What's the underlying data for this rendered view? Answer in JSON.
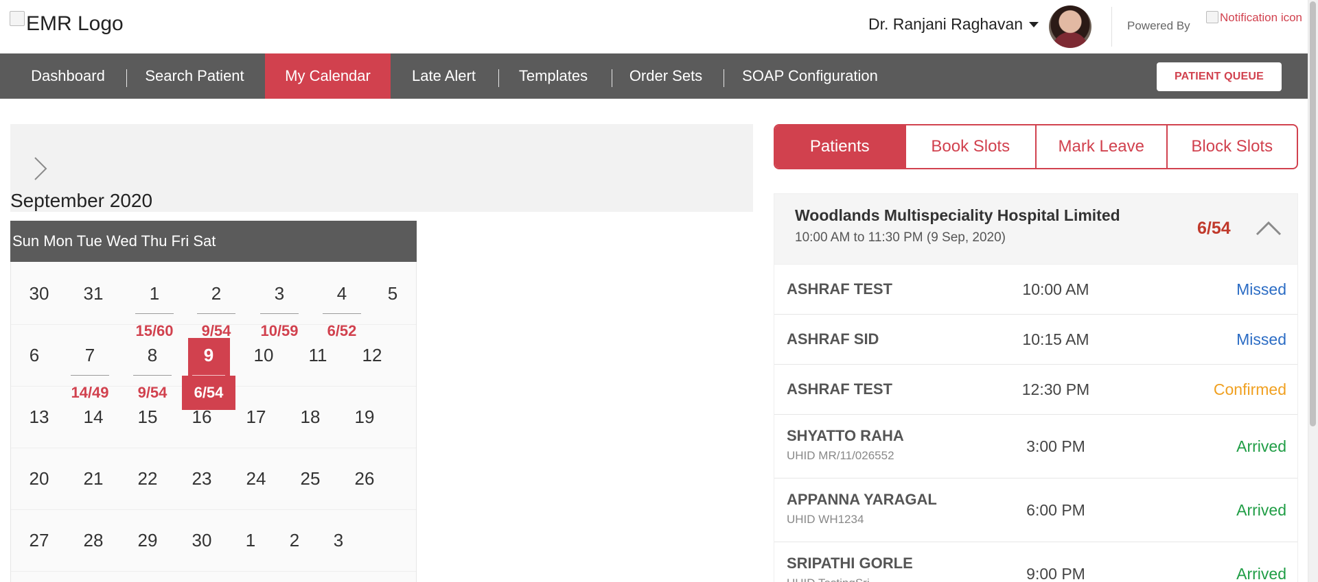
{
  "header": {
    "logo_alt": "EMR Logo",
    "user_name": "Dr. Ranjani Raghavan",
    "powered_by": "Powered By",
    "notification_alt": "Notification icon"
  },
  "nav": {
    "items": [
      "Dashboard",
      "Search Patient",
      "My Calendar",
      "Late Alert",
      "Templates",
      "Order Sets",
      "SOAP Configuration"
    ],
    "active": "My Calendar",
    "queue_button": "PATIENT QUEUE"
  },
  "calendar": {
    "month_label": "September 2020",
    "week_header": "Sun Mon Tue Wed Thu Fri Sat",
    "weeks": [
      [
        {
          "d": "30"
        },
        {
          "d": "31"
        },
        {
          "d": "1",
          "c": "15/60"
        },
        {
          "d": "2",
          "c": "9/54"
        },
        {
          "d": "3",
          "c": "10/59"
        },
        {
          "d": "4",
          "c": "6/52"
        },
        {
          "d": "5"
        }
      ],
      [
        {
          "d": "6"
        },
        {
          "d": "7",
          "c": "14/49"
        },
        {
          "d": "8",
          "c": "9/54"
        },
        {
          "d": "9",
          "c": "6/54",
          "selected": true
        },
        {
          "d": "10"
        },
        {
          "d": "11"
        },
        {
          "d": "12"
        }
      ],
      [
        {
          "d": "13"
        },
        {
          "d": "14"
        },
        {
          "d": "15"
        },
        {
          "d": "16"
        },
        {
          "d": "17"
        },
        {
          "d": "18"
        },
        {
          "d": "19"
        }
      ],
      [
        {
          "d": "20"
        },
        {
          "d": "21"
        },
        {
          "d": "22"
        },
        {
          "d": "23"
        },
        {
          "d": "24"
        },
        {
          "d": "25"
        },
        {
          "d": "26"
        }
      ],
      [
        {
          "d": "27"
        },
        {
          "d": "28"
        },
        {
          "d": "29"
        },
        {
          "d": "30"
        },
        {
          "d": "1"
        },
        {
          "d": "2"
        },
        {
          "d": "3"
        }
      ]
    ]
  },
  "tabs": {
    "items": [
      "Patients",
      "Book Slots",
      "Mark Leave",
      "Block Slots"
    ],
    "active": "Patients"
  },
  "hospital": {
    "name": "Woodlands Multispeciality Hospital Limited",
    "timing": "10:00 AM to 11:30 PM (9 Sep, 2020)",
    "count": "6/54"
  },
  "appointments": [
    {
      "name": "ASHRAF TEST",
      "uhid": "",
      "time": "10:00 AM",
      "status": "Missed"
    },
    {
      "name": "ASHRAF SID",
      "uhid": "",
      "time": "10:15 AM",
      "status": "Missed"
    },
    {
      "name": "ASHRAF TEST",
      "uhid": "",
      "time": "12:30 PM",
      "status": "Confirmed"
    },
    {
      "name": "SHYATTO RAHA",
      "uhid": "UHID MR/11/026552",
      "time": "3:00 PM",
      "status": "Arrived"
    },
    {
      "name": "APPANNA YARAGAL",
      "uhid": "UHID WH1234",
      "time": "6:00 PM",
      "status": "Arrived"
    },
    {
      "name": "SRIPATHI GORLE",
      "uhid": "UHID TestingSri",
      "time": "9:00 PM",
      "status": "Arrived"
    }
  ],
  "colors": {
    "accent": "#d1414e",
    "nav_bg": "#5b5b5b",
    "missed": "#2b6cc4",
    "confirmed": "#f0a020",
    "arrived": "#1f9d45"
  }
}
